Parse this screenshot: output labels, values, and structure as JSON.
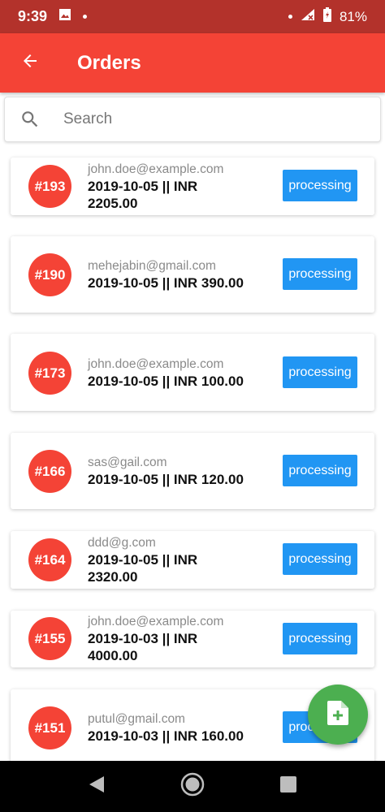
{
  "status_bar": {
    "time": "9:39",
    "battery": "81%"
  },
  "app_bar": {
    "title": "Orders"
  },
  "search": {
    "placeholder": "Search"
  },
  "orders": [
    {
      "id": "#193",
      "email": "john.doe@example.com",
      "line1": "2019-10-05  ||  INR",
      "line2": "2205.00",
      "status": "processing"
    },
    {
      "id": "#190",
      "email": "mehejabin@gmail.com",
      "line1": "2019-10-05  ||  INR 390.00",
      "line2": "",
      "status": "processing"
    },
    {
      "id": "#173",
      "email": "john.doe@example.com",
      "line1": "2019-10-05  ||  INR 100.00",
      "line2": "",
      "status": "processing"
    },
    {
      "id": "#166",
      "email": "sas@gail.com",
      "line1": "2019-10-05  ||  INR 120.00",
      "line2": "",
      "status": "processing"
    },
    {
      "id": "#164",
      "email": "ddd@g.com",
      "line1": "2019-10-05  ||  INR",
      "line2": "2320.00",
      "status": "processing"
    },
    {
      "id": "#155",
      "email": "john.doe@example.com",
      "line1": "2019-10-03  ||  INR",
      "line2": "4000.00",
      "status": "processing"
    },
    {
      "id": "#151",
      "email": "putul@gmail.com",
      "line1": "2019-10-03  ||  INR 160.00",
      "line2": "",
      "status": "processing"
    }
  ],
  "colors": {
    "primary": "#f44336",
    "status_bar": "#b3322b",
    "button": "#2196f3",
    "fab": "#4caf50"
  },
  "icons": {
    "back": "arrow-left-icon",
    "search": "search-icon",
    "fab": "add-document-icon"
  }
}
